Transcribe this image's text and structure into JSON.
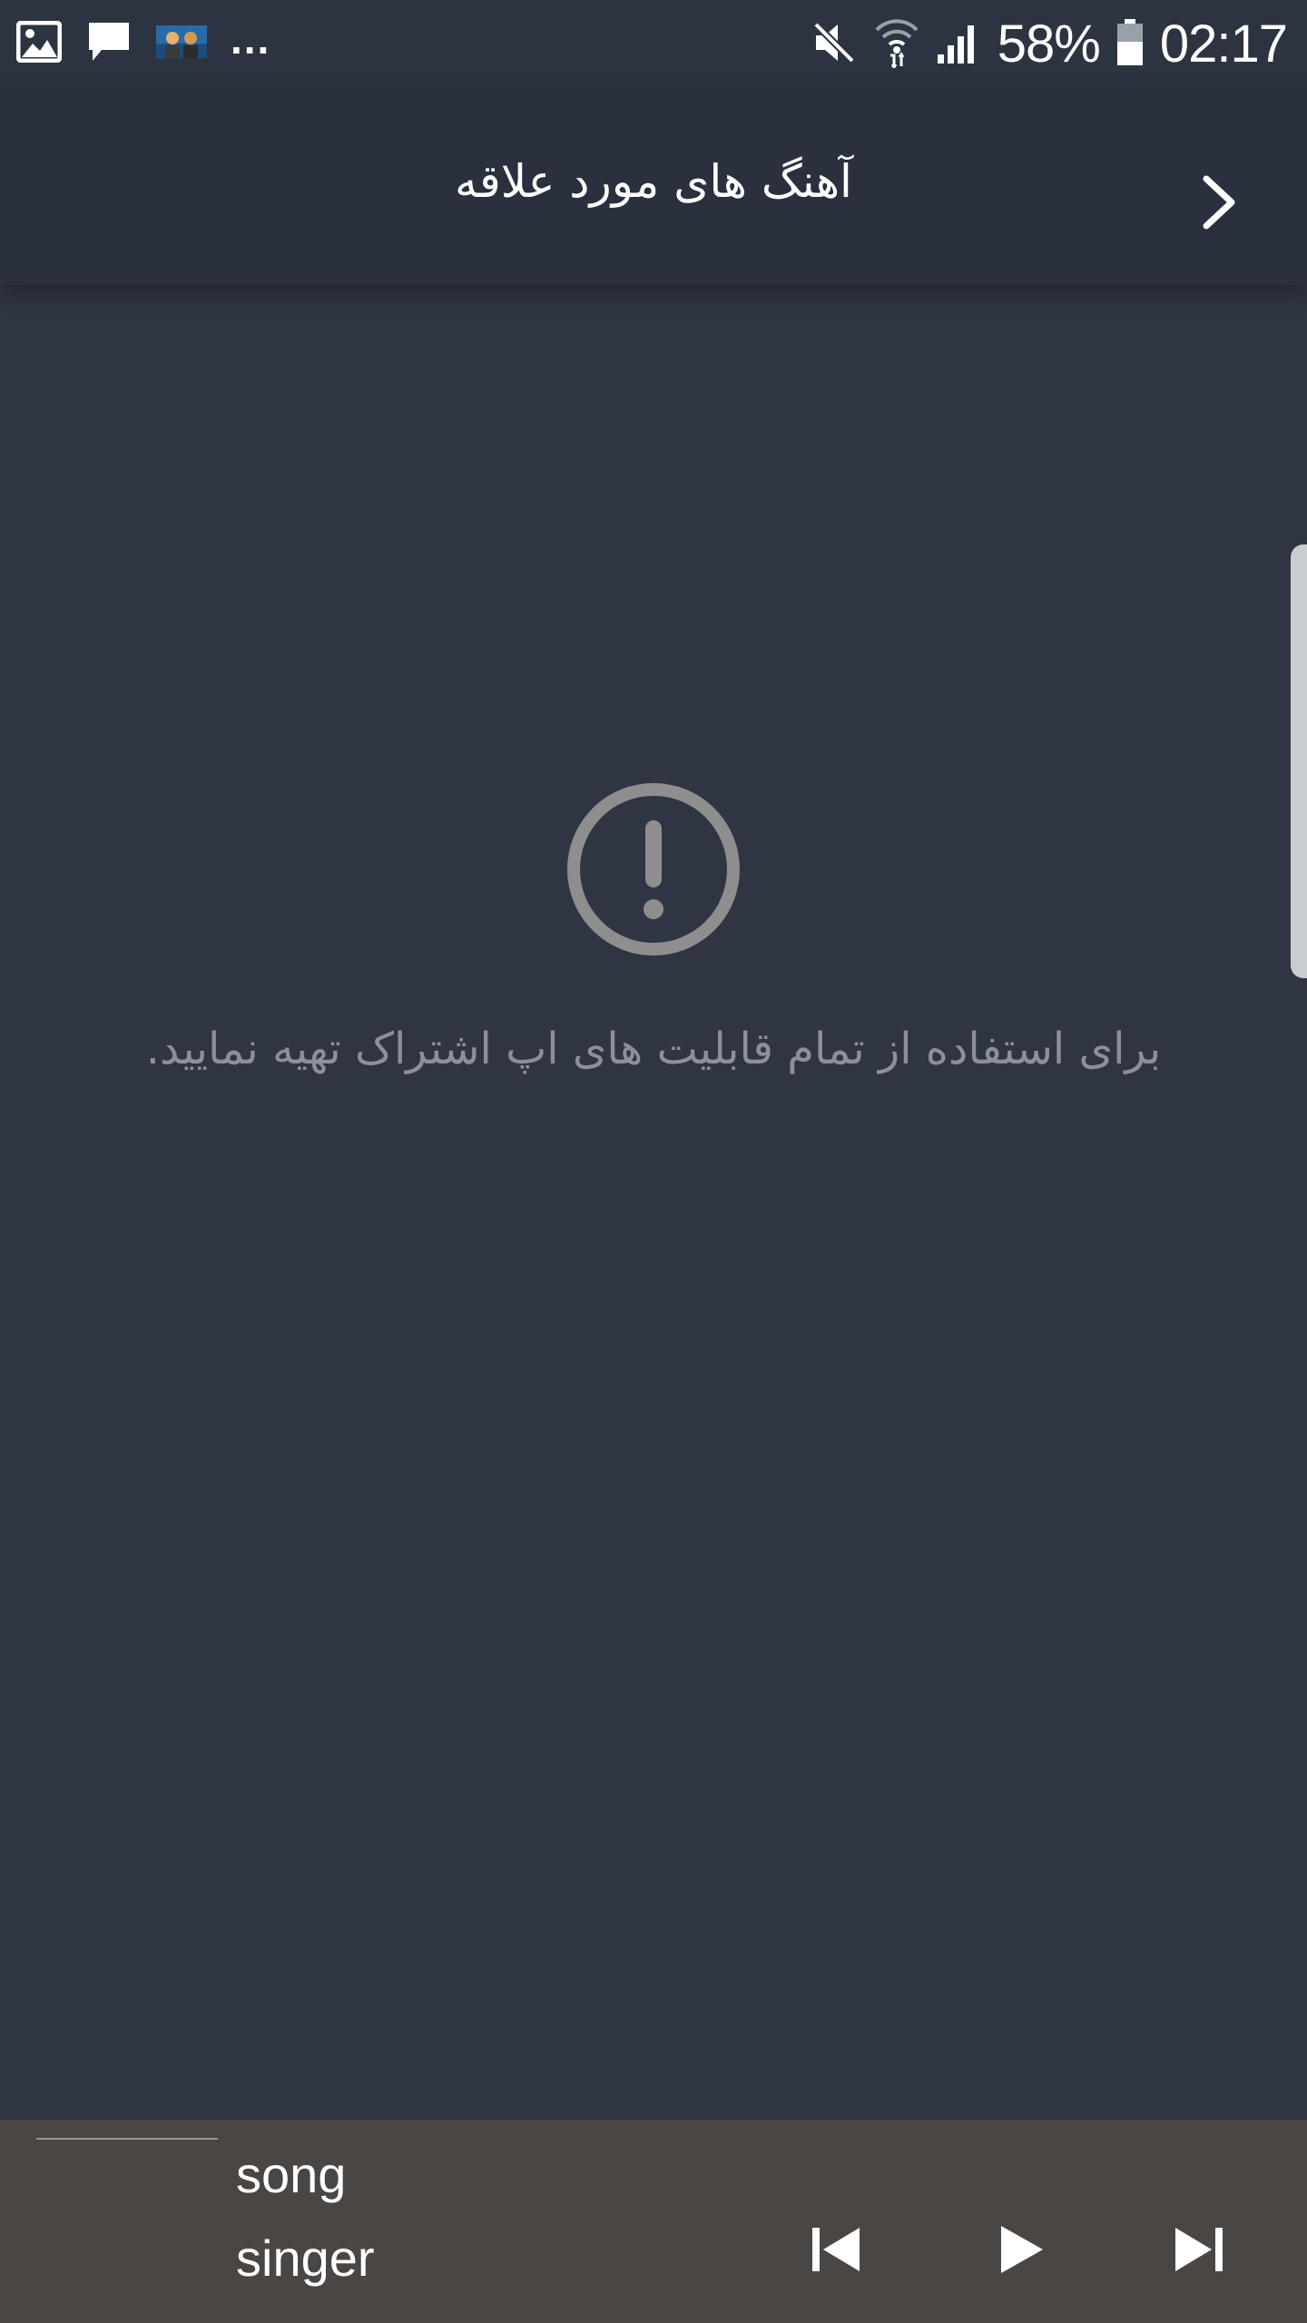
{
  "status_bar": {
    "notification_icons": [
      "gallery-icon",
      "message-icon",
      "app-thumbnail-icon"
    ],
    "more_indicator": "...",
    "system_icons": [
      "mute-icon",
      "wifi-icon",
      "signal-icon",
      "battery-icon"
    ],
    "battery": "58%",
    "time": "02:17"
  },
  "header": {
    "title": "آهنگ های مورد علاقه",
    "back_icon": "chevron-right-icon"
  },
  "empty_state": {
    "icon": "alert-circle-icon",
    "message": "برای استفاده از تمام قابلیت های اپ اشتراک تهیه نمایید."
  },
  "player": {
    "song": "song",
    "singer": "singer",
    "controls": [
      "skip-previous-icon",
      "play-icon",
      "skip-next-icon"
    ]
  },
  "colors": {
    "background": "#2f3543",
    "header": "#2a303d",
    "player": "#4a4643",
    "muted_text": "#8d9099",
    "icon_gray": "#8e8e8e"
  }
}
